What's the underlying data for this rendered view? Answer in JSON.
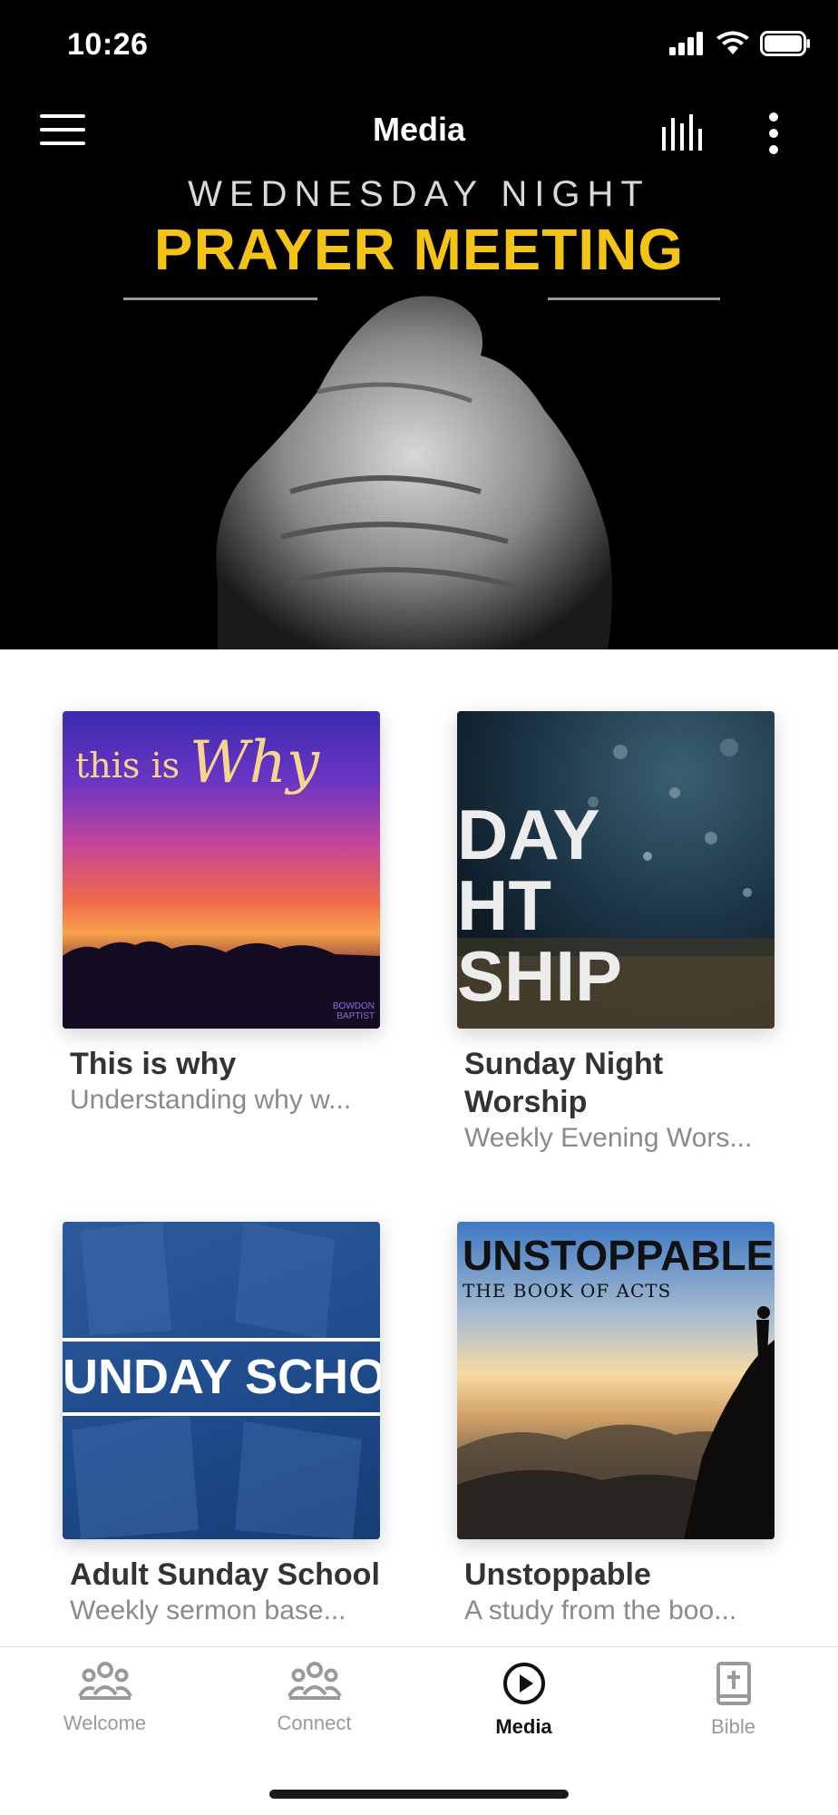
{
  "status": {
    "time": "10:26"
  },
  "header": {
    "title": "Media"
  },
  "hero": {
    "line1": "WEDNESDAY NIGHT",
    "line2": "PRAYER MEETING"
  },
  "cards": [
    {
      "title": "This is why",
      "subtitle": "Understanding why w...",
      "art_text": "this is",
      "art_script": "Why",
      "art_logo": "BOWDON BAPTIST"
    },
    {
      "title": "Sunday Night Worship",
      "subtitle": "Weekly Evening Wors...",
      "art_lines": [
        "DAY",
        "HT",
        "SHIP"
      ]
    },
    {
      "title": "Adult Sunday School",
      "subtitle": "Weekly sermon base...",
      "art_text": "UNDAY SCHOO"
    },
    {
      "title": "Unstoppable",
      "subtitle": "A study from the boo...",
      "art_text": "UNSTOPPABLE",
      "art_sub": "THE BOOK OF ACTS"
    }
  ],
  "tabs": [
    {
      "label": "Welcome",
      "icon": "people-icon"
    },
    {
      "label": "Connect",
      "icon": "people-icon"
    },
    {
      "label": "Media",
      "icon": "play-circle-icon"
    },
    {
      "label": "Bible",
      "icon": "bible-icon"
    }
  ],
  "active_tab": "Media",
  "colors": {
    "accent_yellow": "#f3c316",
    "text_dark": "#333333",
    "text_muted": "#8a8a8a"
  }
}
